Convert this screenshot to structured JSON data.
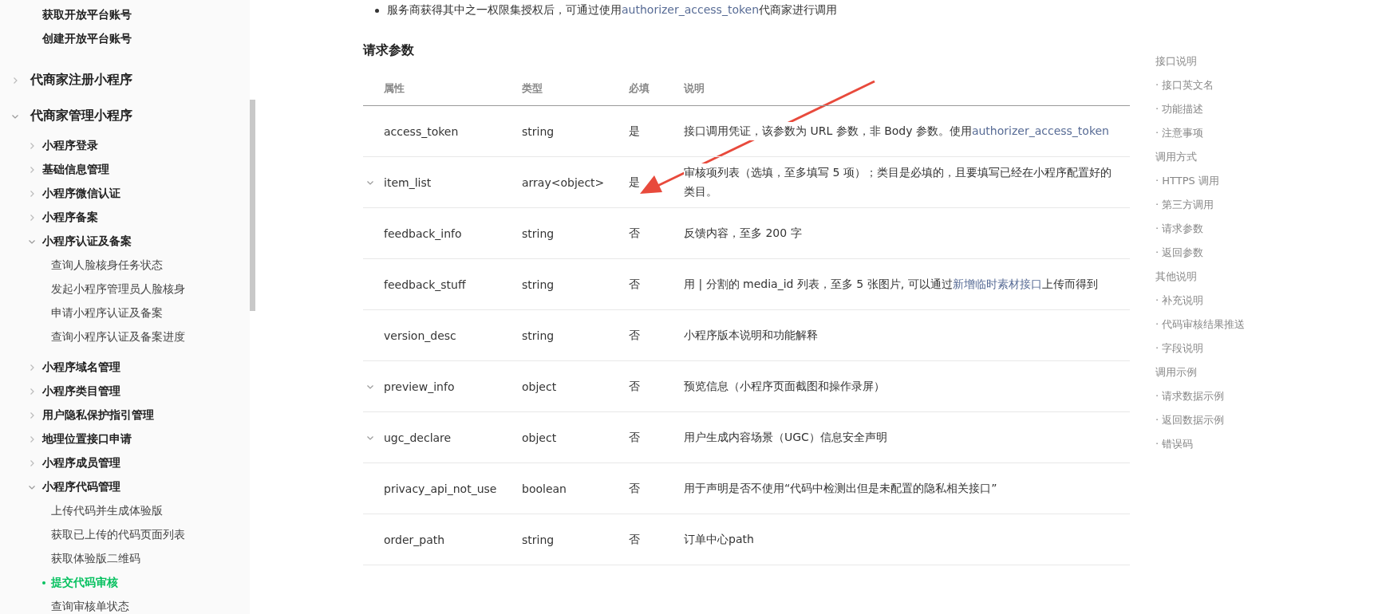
{
  "sidebar": {
    "leading_items": [
      {
        "label": "获取开放平台账号"
      },
      {
        "label": "创建开放平台账号"
      }
    ],
    "sections": [
      {
        "label": "代商家注册小程序",
        "expanded": false
      },
      {
        "label": "代商家管理小程序",
        "expanded": true,
        "children": [
          {
            "label": "小程序登录",
            "expanded": false
          },
          {
            "label": "基础信息管理",
            "expanded": false
          },
          {
            "label": "小程序微信认证",
            "expanded": false
          },
          {
            "label": "小程序备案",
            "expanded": false
          },
          {
            "label": "小程序认证及备案",
            "expanded": true,
            "children": [
              {
                "label": "查询人脸核身任务状态",
                "selected": false
              },
              {
                "label": "发起小程序管理员人脸核身",
                "selected": false
              },
              {
                "label": "申请小程序认证及备案",
                "selected": false
              },
              {
                "label": "查询小程序认证及备案进度",
                "selected": false
              }
            ]
          },
          {
            "label": "小程序域名管理",
            "expanded": false
          },
          {
            "label": "小程序类目管理",
            "expanded": false
          },
          {
            "label": "用户隐私保护指引管理",
            "expanded": false
          },
          {
            "label": "地理位置接口申请",
            "expanded": false
          },
          {
            "label": "小程序成员管理",
            "expanded": false
          },
          {
            "label": "小程序代码管理",
            "expanded": true,
            "children": [
              {
                "label": "上传代码并生成体验版",
                "selected": false
              },
              {
                "label": "获取已上传的代码页面列表",
                "selected": false
              },
              {
                "label": "获取体验版二维码",
                "selected": false
              },
              {
                "label": "提交代码审核",
                "selected": true
              },
              {
                "label": "查询审核单状态",
                "selected": false
              }
            ]
          }
        ]
      }
    ]
  },
  "content": {
    "note": [
      {
        "kind": "text",
        "text": "服务商获得其中之一权限集授权后，可通过使用"
      },
      {
        "kind": "link",
        "text": "authorizer_access_token"
      },
      {
        "kind": "text",
        "text": "代商家进行调用"
      }
    ],
    "heading": "请求参数",
    "table": {
      "columns": [
        "属性",
        "类型",
        "必填",
        "说明"
      ],
      "rows": [
        {
          "expandable": false,
          "name": "access_token",
          "type": "string",
          "required": "是",
          "description": [
            {
              "kind": "text",
              "text": "接口调用凭证，该参数为 URL 参数，非 Body 参数。使用"
            },
            {
              "kind": "link",
              "text": "authorizer_access_token"
            }
          ]
        },
        {
          "expandable": true,
          "name": "item_list",
          "type": "array<object>",
          "required": "是",
          "description": [
            {
              "kind": "text",
              "text": "审核项列表（选填，至多填写 5 项）；类目是必填的，且要填写已经在小程序配置好的类目。"
            }
          ]
        },
        {
          "expandable": false,
          "name": "feedback_info",
          "type": "string",
          "required": "否",
          "description": [
            {
              "kind": "text",
              "text": "反馈内容，至多 200 字"
            }
          ]
        },
        {
          "expandable": false,
          "name": "feedback_stuff",
          "type": "string",
          "required": "否",
          "description": [
            {
              "kind": "text",
              "text": "用 | 分割的 media_id 列表，至多 5 张图片, 可以通过"
            },
            {
              "kind": "link",
              "text": "新增临时素材接口"
            },
            {
              "kind": "text",
              "text": "上传而得到"
            }
          ]
        },
        {
          "expandable": false,
          "name": "version_desc",
          "type": "string",
          "required": "否",
          "description": [
            {
              "kind": "text",
              "text": "小程序版本说明和功能解释"
            }
          ]
        },
        {
          "expandable": true,
          "name": "preview_info",
          "type": "object",
          "required": "否",
          "description": [
            {
              "kind": "text",
              "text": "预览信息（小程序页面截图和操作录屏）"
            }
          ]
        },
        {
          "expandable": true,
          "name": "ugc_declare",
          "type": "object",
          "required": "否",
          "description": [
            {
              "kind": "text",
              "text": "用户生成内容场景（UGC）信息安全声明"
            }
          ]
        },
        {
          "expandable": false,
          "name": "privacy_api_not_use",
          "type": "boolean",
          "required": "否",
          "description": [
            {
              "kind": "text",
              "text": "用于声明是否不使用“代码中检测出但是未配置的隐私相关接口”"
            }
          ]
        },
        {
          "expandable": false,
          "name": "order_path",
          "type": "string",
          "required": "否",
          "description": [
            {
              "kind": "text",
              "text": "订单中心path"
            }
          ]
        }
      ]
    }
  },
  "toc": [
    "接口说明",
    "· 接口英文名",
    "· 功能描述",
    "· 注意事项",
    "调用方式",
    "· HTTPS 调用",
    "· 第三方调用",
    "· 请求参数",
    "· 返回参数",
    "其他说明",
    "· 补充说明",
    "· 代码审核结果推送",
    "· 字段说明",
    "调用示例",
    "· 请求数据示例",
    "· 返回数据示例",
    "· 错误码"
  ]
}
